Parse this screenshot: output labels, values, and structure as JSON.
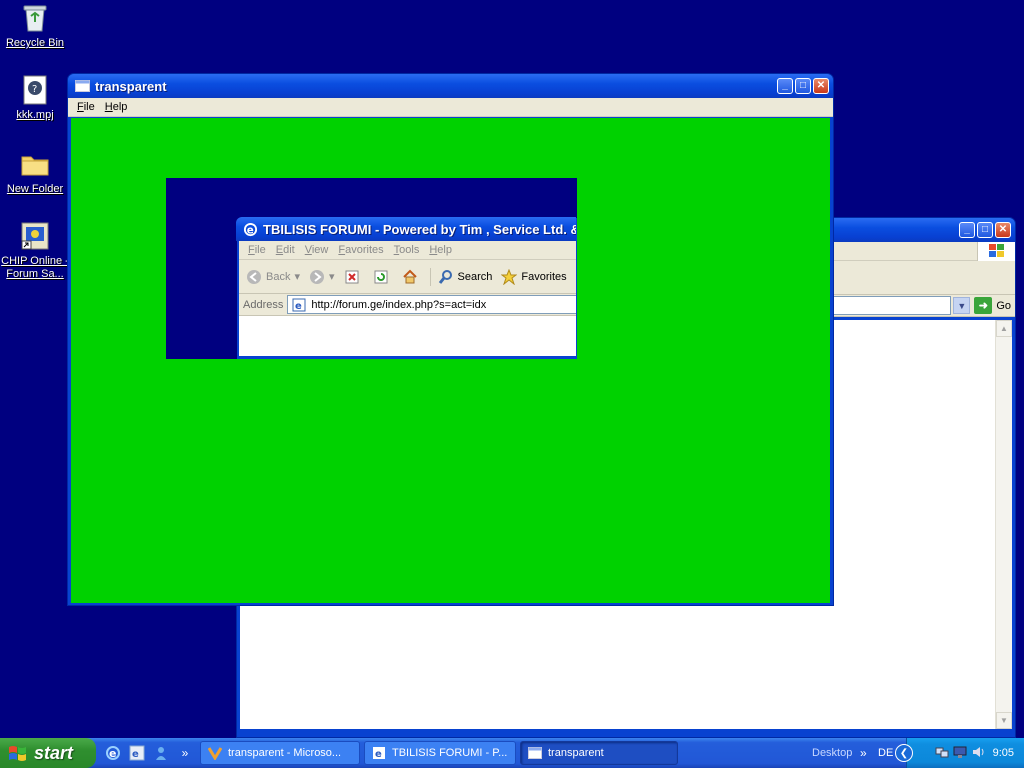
{
  "desktop": {
    "icons": [
      {
        "label": "Recycle Bin",
        "icon": "recycle-bin-icon"
      },
      {
        "label": "kkk.mpj",
        "icon": "project-file-icon"
      },
      {
        "label": "New Folder",
        "icon": "folder-icon"
      },
      {
        "label": "CHIP Online - Forum Sa...",
        "icon": "shortcut-icon"
      }
    ]
  },
  "transparent_window": {
    "title": "transparent",
    "menu": [
      "File",
      "Help"
    ],
    "colors": {
      "canvas": "#00d200",
      "cutout": "#000080"
    }
  },
  "browser_window": {
    "title": "TBILISIS FORUMI - Powered by Tim , Service Ltd. &",
    "menu": [
      "File",
      "Edit",
      "View",
      "Favorites",
      "Tools",
      "Help"
    ],
    "toolbar": {
      "back": "Back",
      "search": "Search",
      "favorites": "Favorites"
    },
    "address": {
      "label": "Address",
      "url": "http://forum.ge/index.php?s=act=idx",
      "go": "Go"
    }
  },
  "taskbar": {
    "start": "start",
    "tasks": [
      {
        "label": "transparent - Microso...",
        "active": false
      },
      {
        "label": "TBILISIS FORUMI - P...",
        "active": false
      },
      {
        "label": "transparent",
        "active": true
      }
    ],
    "desktop_label": "Desktop",
    "language": "DE",
    "time": "9:05"
  }
}
